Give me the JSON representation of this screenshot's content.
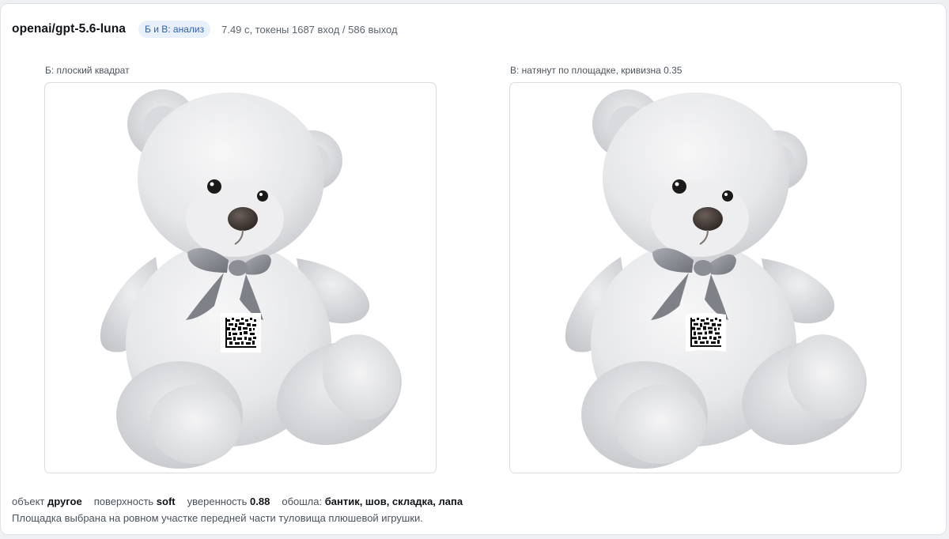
{
  "header": {
    "model": "openai/gpt-5.6-luna",
    "badge": "Б и В: анализ",
    "meta": "7.49 с, токены 1687 вход / 586 выход"
  },
  "panels": [
    {
      "caption": "Б: плоский квадрат",
      "image": "teddy-bear-with-datamatrix-code"
    },
    {
      "caption": "В: натянут по площадке, кривизна 0.35",
      "image": "teddy-bear-with-curved-datamatrix-code"
    }
  ],
  "footer": {
    "object_label": "объект",
    "object_value": "другое",
    "surface_label": "поверхность",
    "surface_value": "soft",
    "confidence_label": "уверенность",
    "confidence_value": "0.88",
    "avoided_label": "обошла:",
    "avoided_value": "бантик, шов, складка, лапа",
    "note": "Площадка выбрана на ровном участке передней части туловища плюшевой игрушки."
  },
  "colors": {
    "badge_bg": "#e7f0fb",
    "badge_text": "#2f62b8",
    "fur": "#e9eaec",
    "ribbon": "#8d9096"
  }
}
